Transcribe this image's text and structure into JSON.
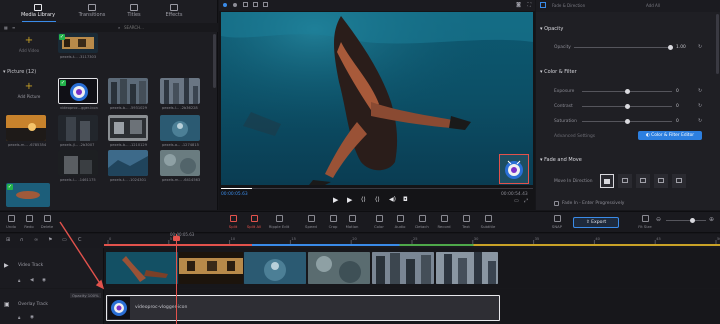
{
  "media_panel": {
    "tabs": [
      {
        "label": "Media Library",
        "active": true
      },
      {
        "label": "Transitions",
        "active": false
      },
      {
        "label": "Titles",
        "active": false
      },
      {
        "label": "Effects",
        "active": false
      }
    ],
    "search_placeholder": "SEARCH...",
    "add_video_label": "Add Video",
    "video_item": {
      "label": "pexels-t... -3117303"
    },
    "picture_section": {
      "title": "Picture (12)"
    },
    "add_picture_label": "Add Picture",
    "picture_items": [
      {
        "label": "videoproc...gger-icon"
      },
      {
        "label": "pexels-b... -5931029"
      },
      {
        "label": "pexels-l... -2b36228"
      },
      {
        "label": "pexels-m... -6785354"
      },
      {
        "label": "pexels-jl... -2b3007"
      },
      {
        "label": "pexels-b... -1210129"
      },
      {
        "label": "pexels-a... -1274815"
      },
      {
        "label": "pexels-l... -1461175"
      },
      {
        "label": "pexels-t... -1024301"
      },
      {
        "label": "pexels-m... -6414563"
      }
    ]
  },
  "player": {
    "timecode": "00:00:05.63",
    "duration": "00:00:54.43",
    "playhead_progress": 0.1,
    "colors": {
      "accent": "#3a8be8"
    }
  },
  "properties_panel": {
    "top_labels": {
      "section": "Fade & Direction",
      "add_all": "Add All"
    },
    "opacity": {
      "section": "Opacity",
      "label": "Opacity",
      "value": "1.00"
    },
    "color_filter": {
      "section": "Color & Filter",
      "rows": [
        {
          "label": "Exposure",
          "value": "0"
        },
        {
          "label": "Contrast",
          "value": "0"
        },
        {
          "label": "Saturation",
          "value": "0"
        }
      ],
      "advanced_label": "Advanced Settings",
      "editor_button": "Color & Filter Editor"
    },
    "fade_move": {
      "section": "Fade and Move",
      "move_label": "Move In Direction",
      "fade_in_label": "Fade In - Enter Progressively"
    }
  },
  "toolbar": {
    "left_tools": [
      {
        "label": "Undo",
        "icon": "undo-icon"
      },
      {
        "label": "Redo",
        "icon": "redo-icon"
      },
      {
        "label": "Delete",
        "icon": "trash-icon"
      }
    ],
    "tools": [
      {
        "label": "Split",
        "icon": "scissors-icon",
        "red": true
      },
      {
        "label": "Split All",
        "icon": "split-all-icon",
        "red": true
      },
      {
        "label": "Ripple Edit",
        "icon": "ripple-edit-icon",
        "red": false
      },
      {
        "label": "Speed",
        "icon": "speed-icon",
        "red": false
      },
      {
        "label": "Crop",
        "icon": "crop-icon",
        "red": false
      },
      {
        "label": "Motion",
        "icon": "motion-icon",
        "red": false
      },
      {
        "label": "Color",
        "icon": "palette-icon",
        "red": false
      },
      {
        "label": "Audio",
        "icon": "audio-icon",
        "red": false
      },
      {
        "label": "Detach",
        "icon": "detach-icon",
        "red": false
      },
      {
        "label": "Record",
        "icon": "microphone-icon",
        "red": false
      },
      {
        "label": "Text",
        "icon": "text-icon",
        "red": false
      },
      {
        "label": "Subtitle",
        "icon": "subtitle-icon",
        "red": false
      }
    ],
    "snap_label": "SNAP",
    "export_label": "Export",
    "fit_size_label": "Fit Size"
  },
  "timeline": {
    "ruler_time": "00:00:05.63",
    "ruler_ticks": [
      "0",
      "5",
      "10",
      "15",
      "20",
      "25",
      "30",
      "35",
      "40",
      "45",
      "50"
    ],
    "tracks": [
      {
        "name": "Video Track"
      },
      {
        "name": "Overlay Track"
      }
    ],
    "opacity_badge": "Opacity 100%",
    "overlay_clip_label": "videoproc-vlogger-icon"
  }
}
